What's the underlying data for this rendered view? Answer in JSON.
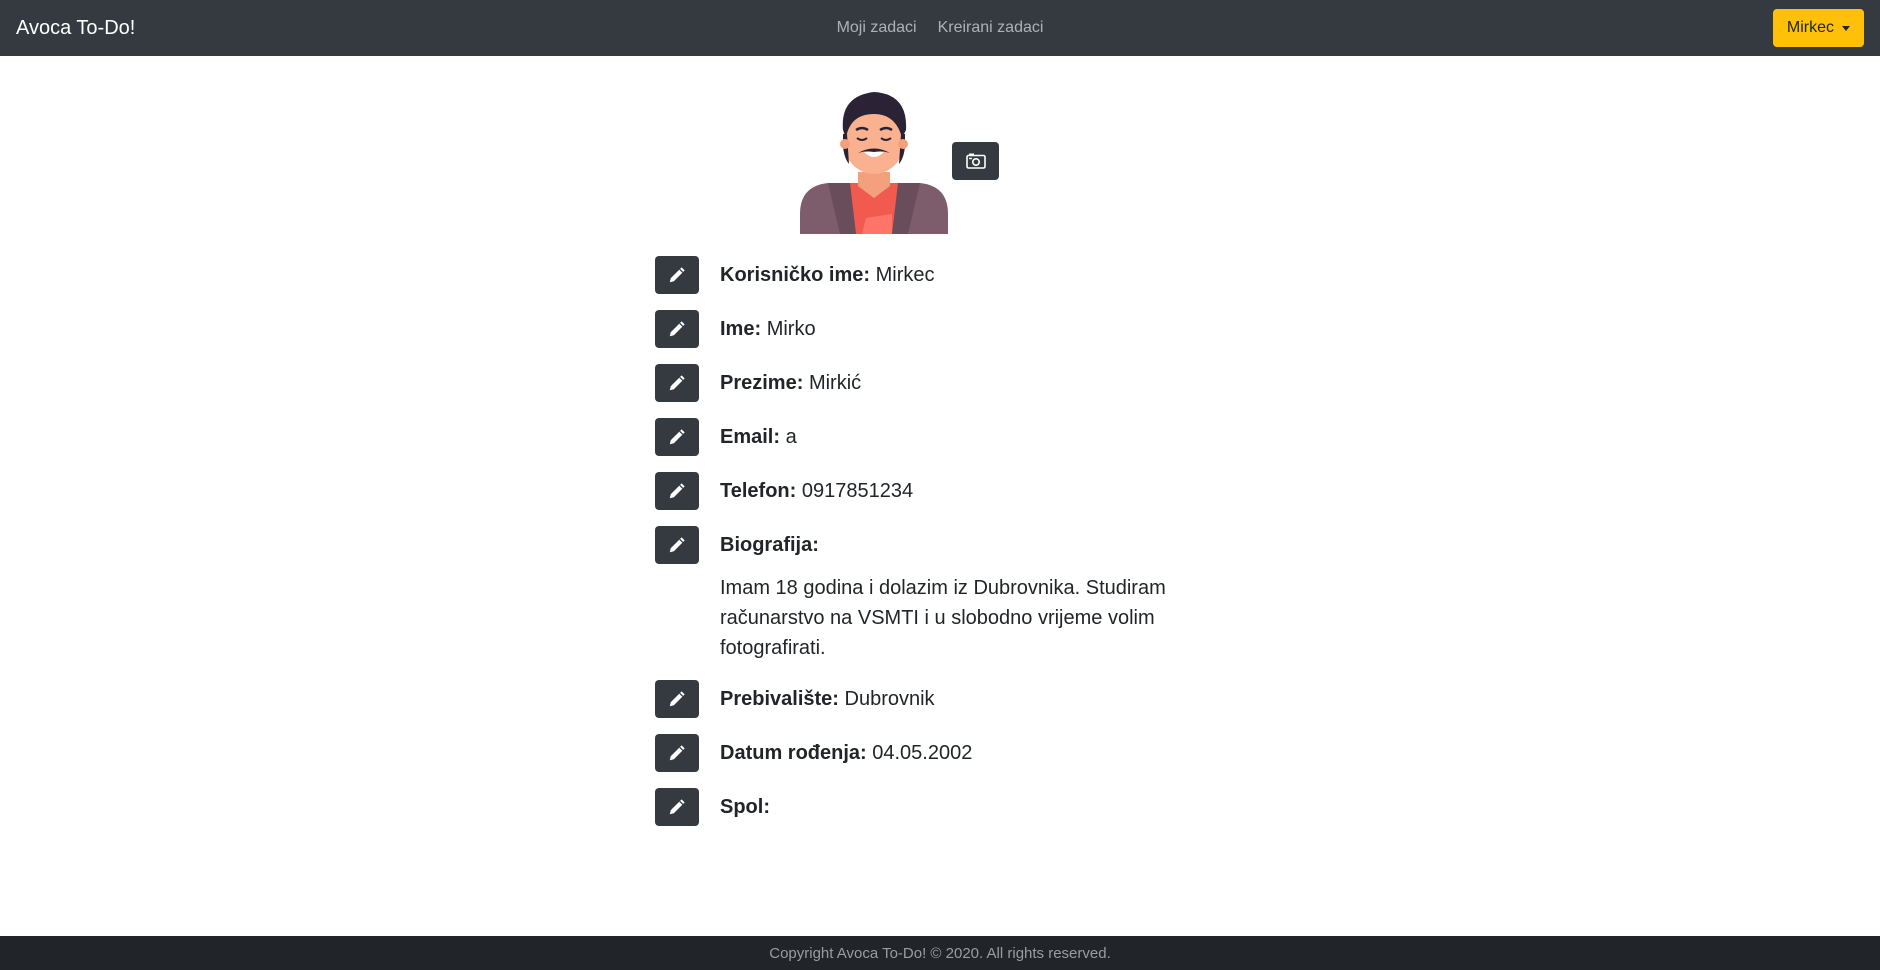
{
  "navbar": {
    "brand": "Avoca To-Do!",
    "links": [
      "Moji zadaci",
      "Kreirani zadaci"
    ],
    "user_button": "Mirkec"
  },
  "profile": {
    "fields": [
      {
        "label": "Korisničko ime:",
        "value": "Mirkec"
      },
      {
        "label": "Ime:",
        "value": "Mirko"
      },
      {
        "label": "Prezime:",
        "value": "Mirkić"
      },
      {
        "label": "Email:",
        "value": "a"
      },
      {
        "label": "Telefon:",
        "value": "0917851234"
      },
      {
        "label": "Biografija:",
        "value": ""
      },
      {
        "label": "Prebivalište:",
        "value": "Dubrovnik"
      },
      {
        "label": "Datum rođenja:",
        "value": "04.05.2002"
      },
      {
        "label": "Spol:",
        "value": ""
      }
    ],
    "biography": "Imam 18 godina i dolazim iz Dubrovnika. Studiram računarstvo na VSMTI i u slobodno vrijeme volim fotografirati."
  },
  "footer": {
    "text": "Copyright Avoca To-Do! © 2020. All rights reserved."
  },
  "icons": {
    "edit": "pencil-icon",
    "camera": "camera-icon",
    "avatar": "avatar-illustration"
  },
  "colors": {
    "navbar": "#343a40",
    "accent": "#ffc107",
    "footer": "#212529"
  }
}
